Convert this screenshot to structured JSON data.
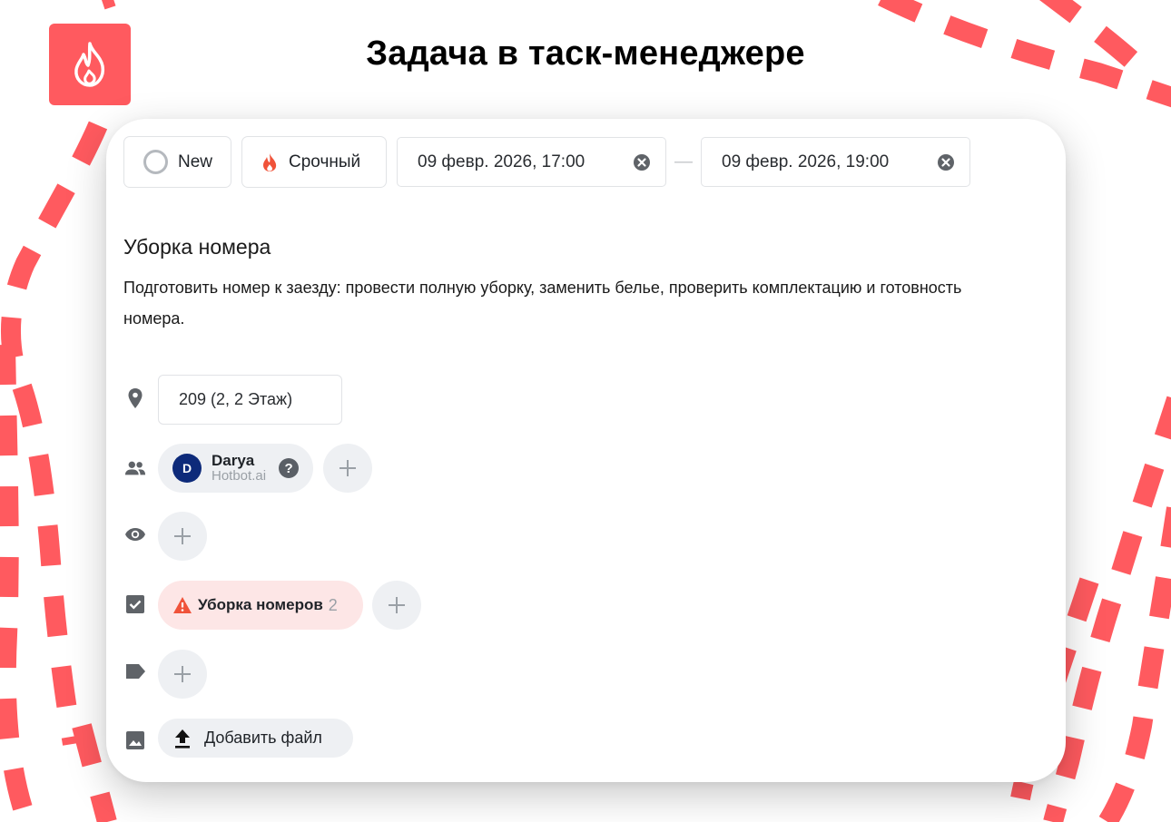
{
  "page": {
    "title": "Задача в таск-менеджере",
    "logo_icon": "flame-logo-icon",
    "accent_color": "#ff5a5f"
  },
  "task": {
    "status_label": "New",
    "priority_label": "Срочный",
    "start_datetime": "09 февр. 2026, 17:00",
    "end_datetime": "09 февр. 2026, 19:00",
    "range_separator": "—",
    "title": "Уборка номера",
    "description": "Подготовить номер к заезду: провести полную уборку, заменить белье, проверить комплектацию и готовность номера.",
    "location": "209 (2, 2 Этаж)",
    "assignee": {
      "initial": "D",
      "name": "Darya",
      "org": "Hotbot.ai",
      "help_glyph": "?"
    },
    "group": {
      "name": "Уборка номеров",
      "count": "2"
    },
    "add_file_label": "Добавить файл"
  }
}
